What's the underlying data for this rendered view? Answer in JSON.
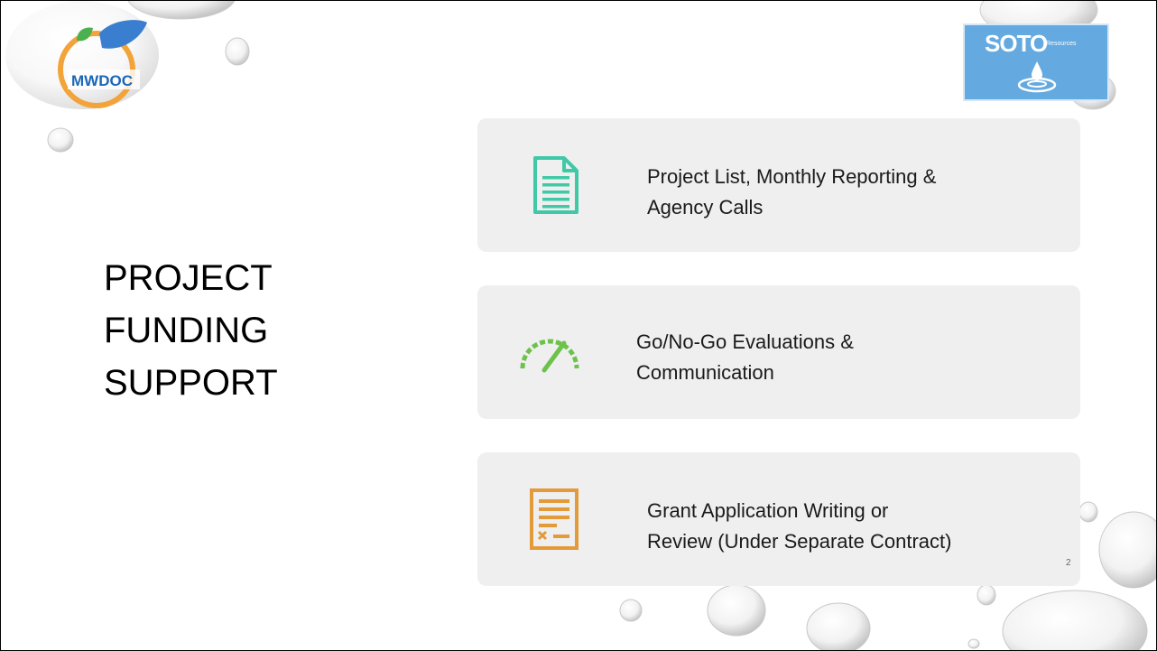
{
  "title": {
    "line1": "PROJECT",
    "line2": "FUNDING",
    "line3": "SUPPORT"
  },
  "logos": {
    "left": "MWDOC",
    "right_main": "SOTO",
    "right_sub": "Resources"
  },
  "cards": [
    {
      "icon": "document-icon",
      "color": "#3fc9a6",
      "line1": "Project List, Monthly Reporting &",
      "line2": "Agency Calls"
    },
    {
      "icon": "gauge-icon",
      "color": "#6cc24a",
      "line1": "Go/No-Go Evaluations &",
      "line2": "Communication"
    },
    {
      "icon": "form-icon",
      "color": "#e39a3b",
      "line1": "Grant Application Writing or",
      "line2": "Review (Under Separate Contract)"
    }
  ],
  "page_number": "2"
}
